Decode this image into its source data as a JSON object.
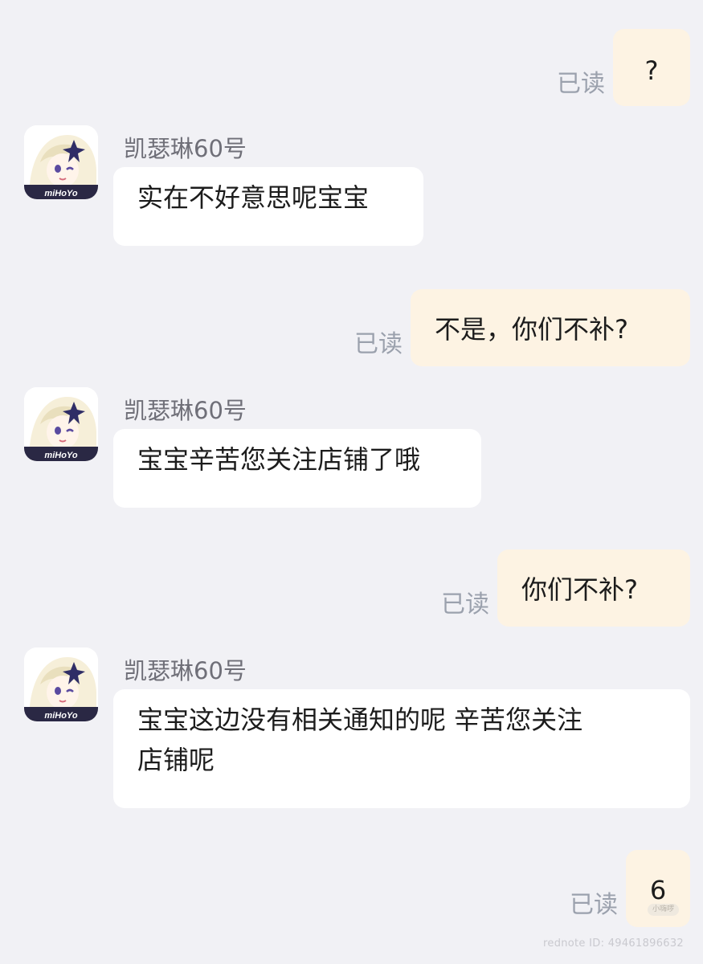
{
  "messages": [
    {
      "direction": "out",
      "text": "?",
      "status": "已读"
    },
    {
      "direction": "in",
      "sender": "凯瑟琳60号",
      "text": "实在不好意思呢宝宝"
    },
    {
      "direction": "out",
      "text": "不是，你们不补?",
      "status": "已读"
    },
    {
      "direction": "in",
      "sender": "凯瑟琳60号",
      "text": "宝宝辛苦您关注店铺了哦"
    },
    {
      "direction": "out",
      "text": "你们不补?",
      "status": "已读"
    },
    {
      "direction": "in",
      "sender": "凯瑟琳60号",
      "text_line1": "宝宝这边没有相关通知的呢 辛苦您关注",
      "text_line2": "店铺呢"
    },
    {
      "direction": "out",
      "text": "6",
      "status": "已读",
      "sticker_tag": "小嗨啰"
    }
  ],
  "avatar": {
    "logo_text": "miHoYo"
  },
  "watermark": "rednote ID: 49461896632",
  "colors": {
    "background": "#f1f1f5",
    "outgoing_bubble": "#fdf3e3",
    "incoming_bubble": "#ffffff",
    "read_status": "#9ba1ad",
    "sender_name": "#6f6f78"
  }
}
